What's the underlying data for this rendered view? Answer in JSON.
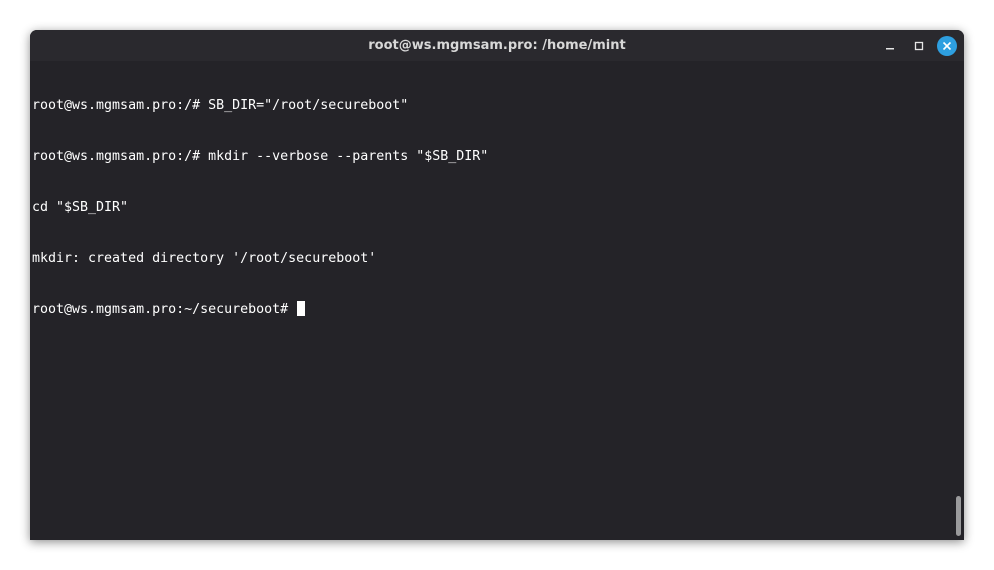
{
  "window": {
    "title": "root@ws.mgmsam.pro: /home/mint"
  },
  "controls": {
    "minimize": "minimize-icon",
    "maximize": "maximize-icon",
    "close": "close-icon"
  },
  "terminal": {
    "lines": [
      "root@ws.mgmsam.pro:/# SB_DIR=\"/root/secureboot\"",
      "root@ws.mgmsam.pro:/# mkdir --verbose --parents \"$SB_DIR\"",
      "cd \"$SB_DIR\"",
      "mkdir: created directory '/root/secureboot'",
      "root@ws.mgmsam.pro:~/secureboot# "
    ]
  },
  "colors": {
    "background": "#242328",
    "titlebar": "#2a292e",
    "text": "#ffffff",
    "close_button": "#2e9fe0"
  }
}
